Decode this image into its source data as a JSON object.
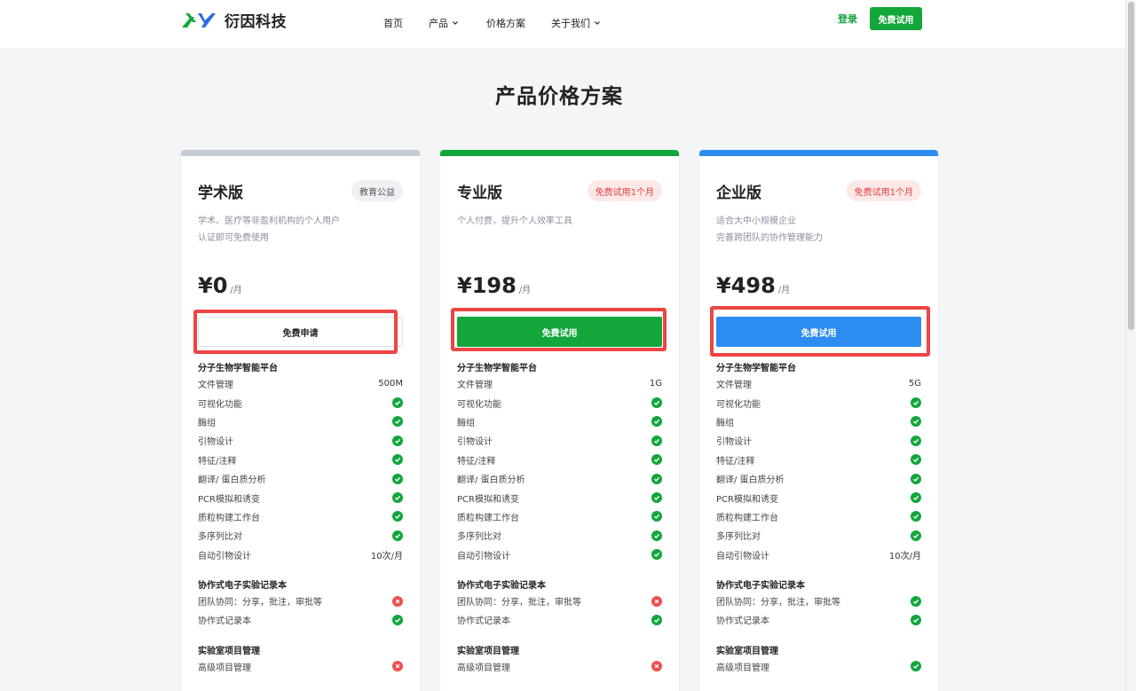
{
  "header": {
    "logo_text": "衍因科技",
    "nav": [
      "首页",
      "产品",
      "价格方案",
      "关于我们"
    ],
    "login": "登录",
    "trial": "免费试用"
  },
  "page_title": "产品价格方案",
  "colors": {
    "green": "#12a63b",
    "blue": "#2d8cf0",
    "gray_bar": "#c3cbd6",
    "red": "#ef4f4f"
  },
  "cards": [
    {
      "name": "学术版",
      "badge": "教育公益",
      "desc1": "学术、医疗等非盈利机构的个人用户",
      "desc2": "认证即可免费使用",
      "price": "¥0",
      "unit": "/月",
      "cta": "免费申请",
      "sections": [
        {
          "title": "分子生物学智能平台",
          "rows": [
            {
              "label": "文件管理",
              "value": "500M"
            },
            {
              "label": "可视化功能",
              "value": "yes"
            },
            {
              "label": "酶组",
              "value": "yes"
            },
            {
              "label": "引物设计",
              "value": "yes"
            },
            {
              "label": "特征/注释",
              "value": "yes"
            },
            {
              "label": "翻译/ 蛋白质分析",
              "value": "yes"
            },
            {
              "label": "PCR模拟和诱变",
              "value": "yes"
            },
            {
              "label": "质粒构建工作台",
              "value": "yes"
            },
            {
              "label": "多序列比对",
              "value": "yes"
            },
            {
              "label": "自动引物设计",
              "value": "10次/月"
            }
          ]
        },
        {
          "title": "协作式电子实验记录本",
          "rows": [
            {
              "label": "团队协同：分享，批注，审批等",
              "value": "no"
            },
            {
              "label": "协作式记录本",
              "value": "yes"
            }
          ]
        },
        {
          "title": "实验室项目管理",
          "rows": [
            {
              "label": "高级项目管理",
              "value": "no"
            }
          ]
        }
      ]
    },
    {
      "name": "专业版",
      "badge": "免费试用1个月",
      "desc1": "个人付费，提升个人效率工具",
      "desc2": "",
      "price": "¥198",
      "unit": "/月",
      "cta": "免费试用",
      "sections": [
        {
          "title": "分子生物学智能平台",
          "rows": [
            {
              "label": "文件管理",
              "value": "1G"
            },
            {
              "label": "可视化功能",
              "value": "yes"
            },
            {
              "label": "酶组",
              "value": "yes"
            },
            {
              "label": "引物设计",
              "value": "yes"
            },
            {
              "label": "特征/注释",
              "value": "yes"
            },
            {
              "label": "翻译/ 蛋白质分析",
              "value": "yes"
            },
            {
              "label": "PCR模拟和诱变",
              "value": "yes"
            },
            {
              "label": "质粒构建工作台",
              "value": "yes"
            },
            {
              "label": "多序列比对",
              "value": "yes"
            },
            {
              "label": "自动引物设计",
              "value": "yes"
            }
          ]
        },
        {
          "title": "协作式电子实验记录本",
          "rows": [
            {
              "label": "团队协同：分享，批注，审批等",
              "value": "no"
            },
            {
              "label": "协作式记录本",
              "value": "yes"
            }
          ]
        },
        {
          "title": "实验室项目管理",
          "rows": [
            {
              "label": "高级项目管理",
              "value": "no"
            }
          ]
        }
      ]
    },
    {
      "name": "企业版",
      "badge": "免费试用1个月",
      "desc1": "适合大中小规模企业",
      "desc2": "完善跨团队的协作管理能力",
      "price": "¥498",
      "unit": "/月",
      "cta": "免费试用",
      "sections": [
        {
          "title": "分子生物学智能平台",
          "rows": [
            {
              "label": "文件管理",
              "value": "5G"
            },
            {
              "label": "可视化功能",
              "value": "yes"
            },
            {
              "label": "酶组",
              "value": "yes"
            },
            {
              "label": "引物设计",
              "value": "yes"
            },
            {
              "label": "特征/注释",
              "value": "yes"
            },
            {
              "label": "翻译/ 蛋白质分析",
              "value": "yes"
            },
            {
              "label": "PCR模拟和诱变",
              "value": "yes"
            },
            {
              "label": "质粒构建工作台",
              "value": "yes"
            },
            {
              "label": "多序列比对",
              "value": "yes"
            },
            {
              "label": "自动引物设计",
              "value": "10次/月"
            }
          ]
        },
        {
          "title": "协作式电子实验记录本",
          "rows": [
            {
              "label": "团队协同：分享，批注，审批等",
              "value": "yes"
            },
            {
              "label": "协作式记录本",
              "value": "yes"
            }
          ]
        },
        {
          "title": "实验室项目管理",
          "rows": [
            {
              "label": "高级项目管理",
              "value": "yes"
            }
          ]
        }
      ]
    }
  ]
}
